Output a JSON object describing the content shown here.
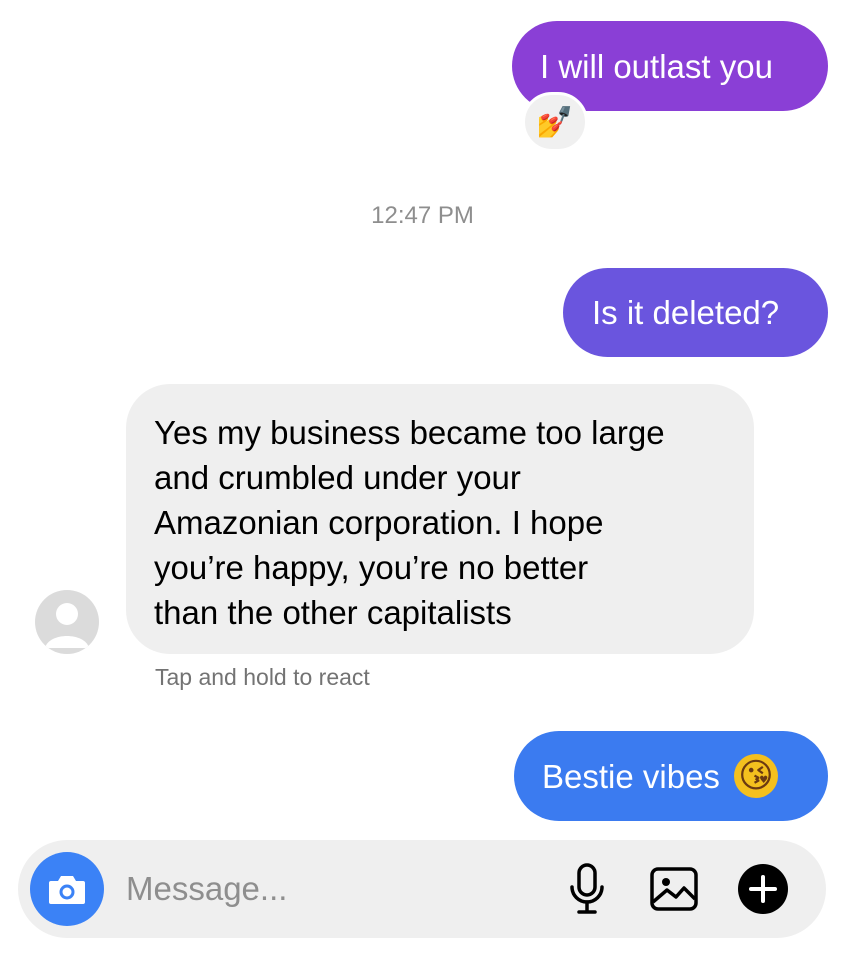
{
  "messages": {
    "outgoing_1": {
      "text": "I will outlast you",
      "color": "#8a3fd6"
    },
    "reaction_1": {
      "icon": "nail-polish-emoji",
      "glyph": "💅"
    },
    "timestamp": "12:47 PM",
    "outgoing_2": {
      "text": "Is it deleted?",
      "color": "#6a55de"
    },
    "incoming_1": {
      "lines": [
        "Yes my business became too large",
        "and crumbled under your",
        "Amazonian corporation. I hope",
        "you’re happy, you’re no better",
        "than the other capitalists"
      ],
      "color": "#efefef"
    },
    "hint": "Tap and hold to react",
    "outgoing_3": {
      "text": "Bestie vibes",
      "emoji": "kissing-face-with-heart-emoji",
      "emoji_glyph": "😘",
      "color": "#3b7bf0"
    }
  },
  "composer": {
    "placeholder": "Message...",
    "camera_icon": "camera-icon",
    "mic_icon": "microphone-icon",
    "gallery_icon": "gallery-icon",
    "plus_icon": "plus-icon",
    "accent": "#3b82f6"
  }
}
